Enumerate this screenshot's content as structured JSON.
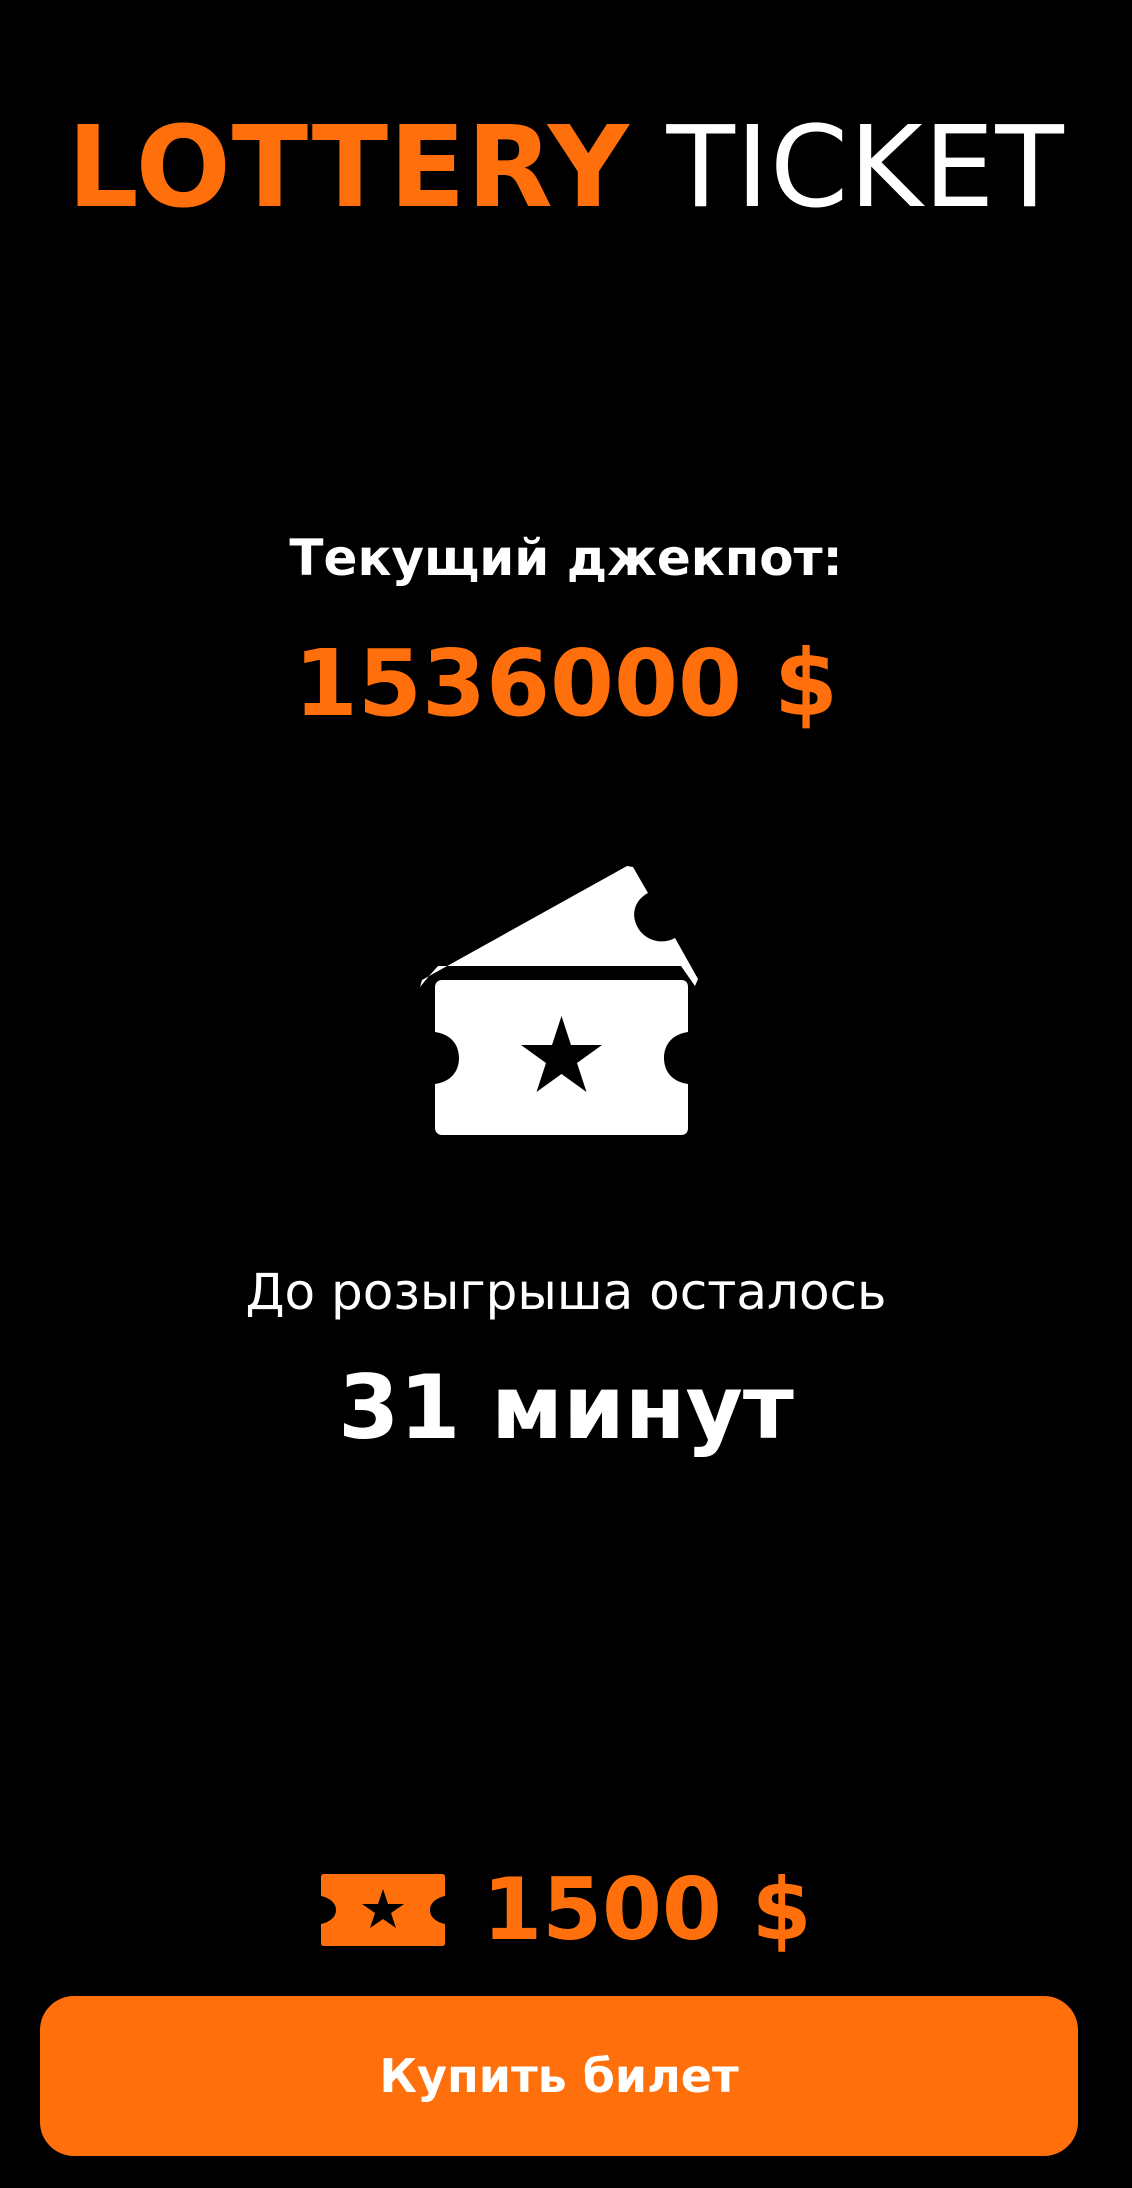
{
  "header": {
    "title_accent": "LOTTERY",
    "title_plain": "TICKET"
  },
  "jackpot": {
    "label": "Текущий джекпот:",
    "value": "1536000 $"
  },
  "countdown": {
    "label": "До розыгрыша осталось",
    "value": "31 минут"
  },
  "ticket": {
    "price": "1500 $"
  },
  "actions": {
    "buy_label": "Купить билет"
  },
  "icons": {
    "hero": "tickets-star-icon",
    "price": "ticket-star-icon"
  },
  "colors": {
    "accent": "#ff6f0b",
    "background": "#000000",
    "text": "#ffffff"
  }
}
